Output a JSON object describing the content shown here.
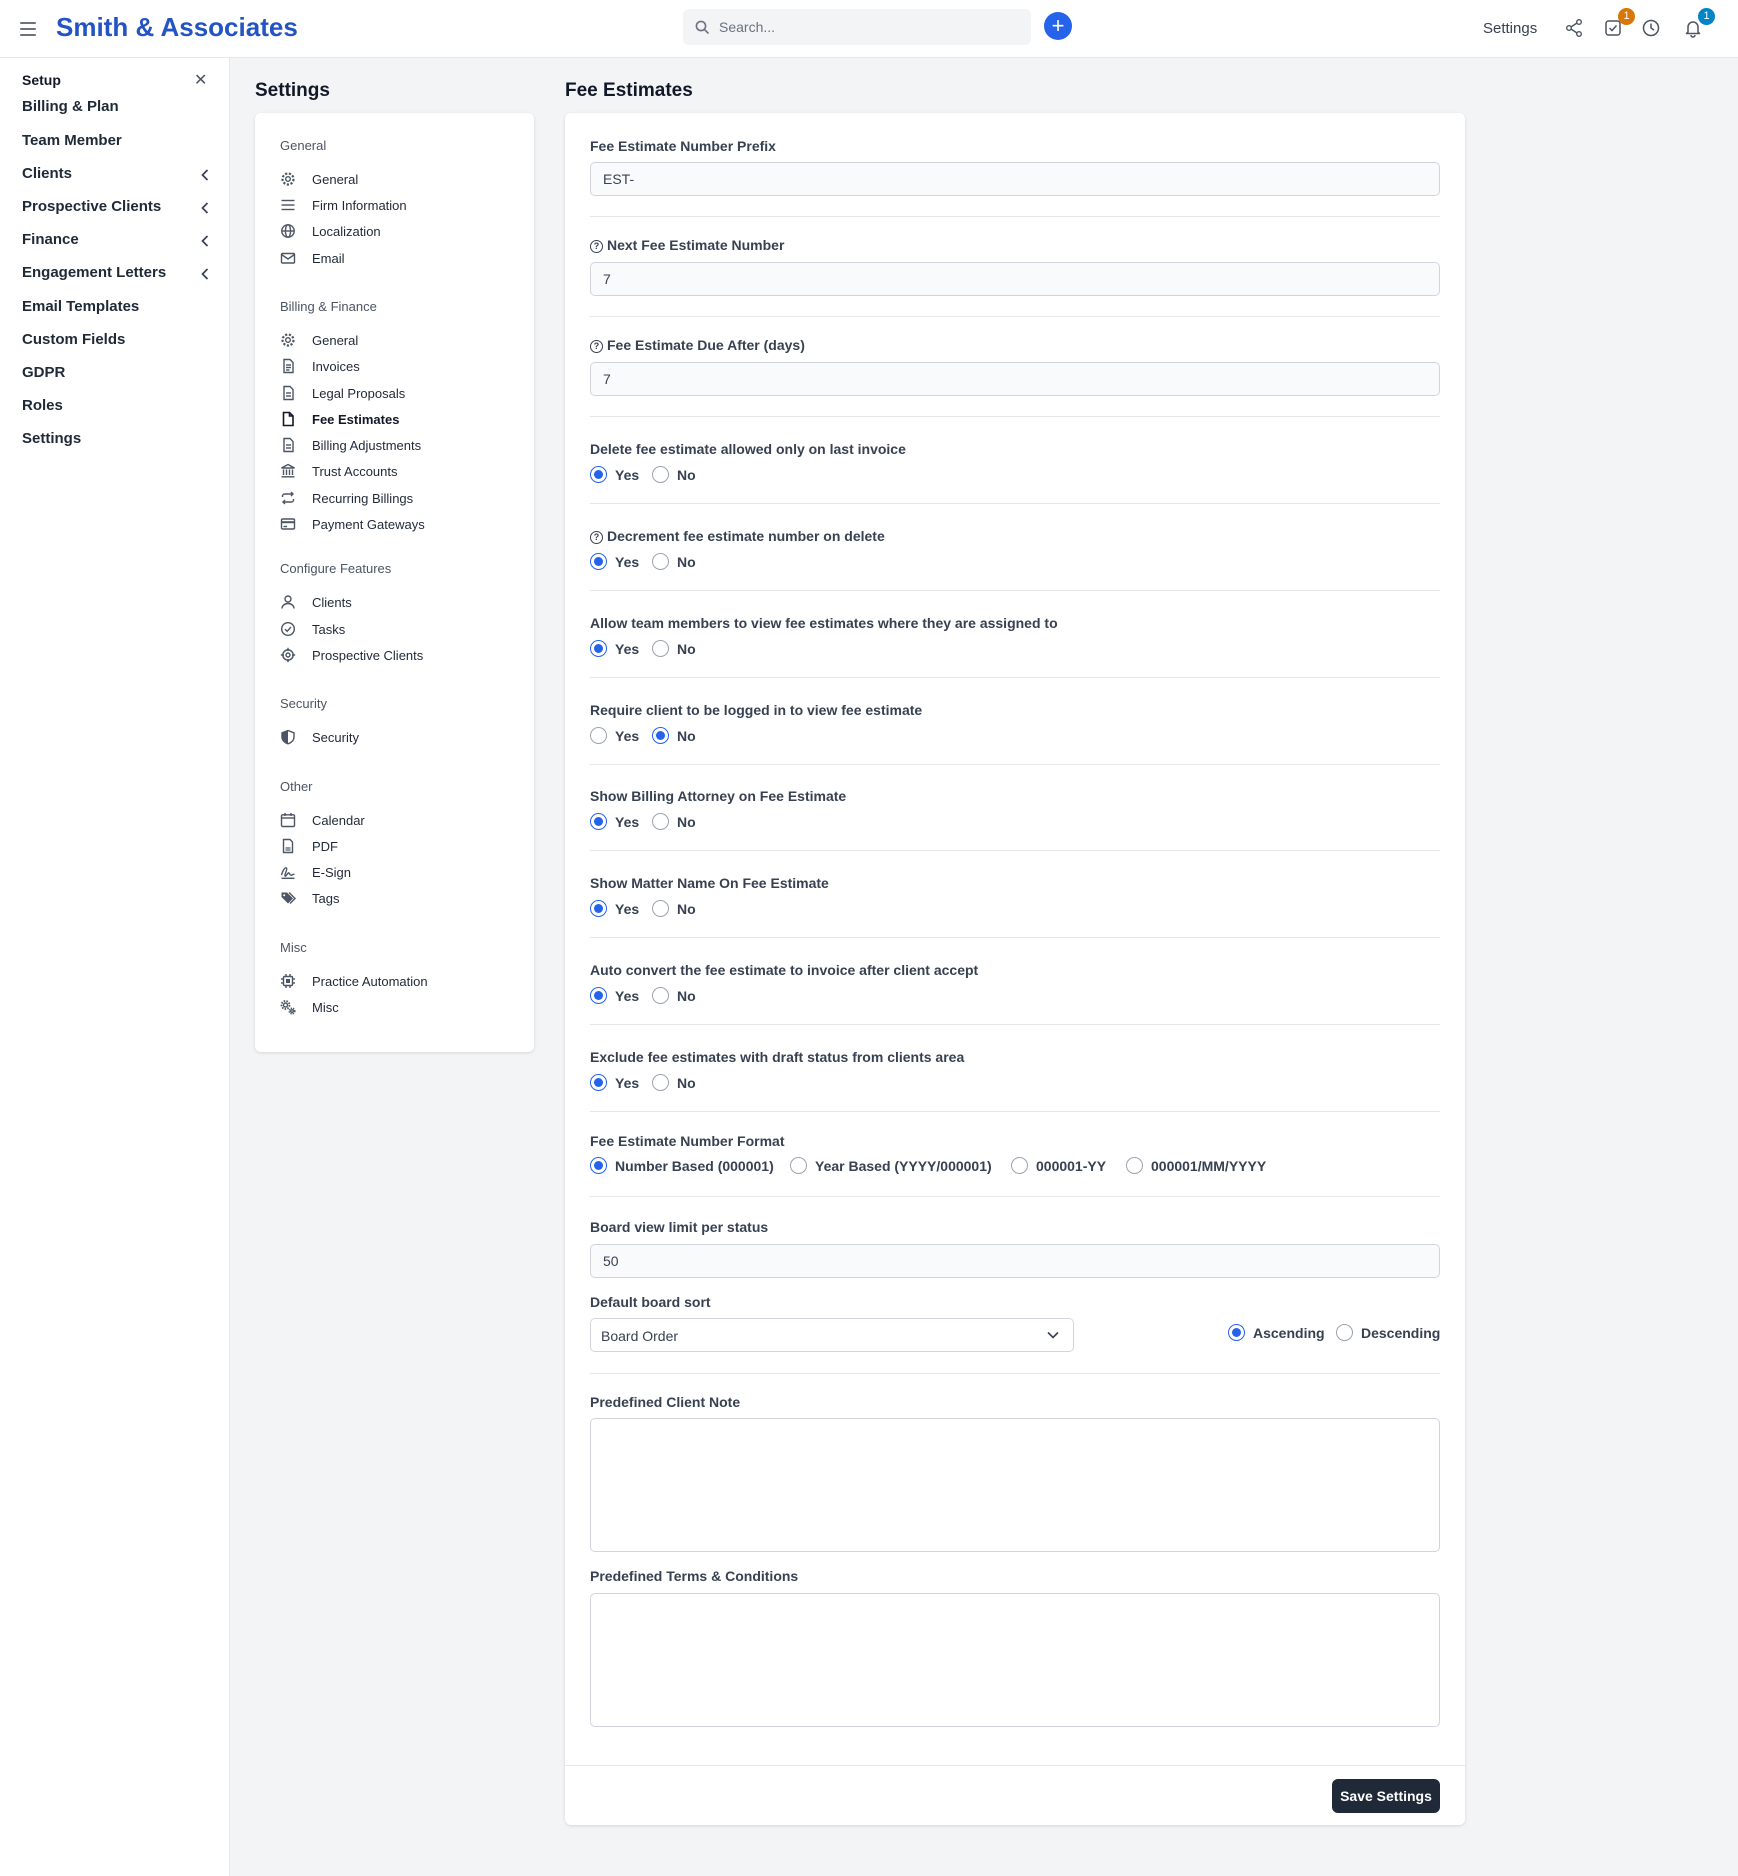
{
  "app": {
    "brand": "Smith & Associates",
    "search_placeholder": "Search...",
    "settings_link": "Settings",
    "tasks_badge": "1",
    "notifications_badge": "1",
    "colors": {
      "brand": "#2454c4",
      "primary": "#2563eb",
      "tasks_badge": "#d97706",
      "notify_badge": "#0284c7",
      "dark_button": "#1f2937"
    }
  },
  "setup": {
    "title": "Setup",
    "items": [
      {
        "label": "Billing & Plan",
        "has_chevron": false
      },
      {
        "label": "Team Member",
        "has_chevron": false
      },
      {
        "label": "Clients",
        "has_chevron": true
      },
      {
        "label": "Prospective Clients",
        "has_chevron": true
      },
      {
        "label": "Finance",
        "has_chevron": true
      },
      {
        "label": "Engagement Letters",
        "has_chevron": true
      },
      {
        "label": "Email Templates",
        "has_chevron": false
      },
      {
        "label": "Custom Fields",
        "has_chevron": false
      },
      {
        "label": "GDPR",
        "has_chevron": false
      },
      {
        "label": "Roles",
        "has_chevron": false
      },
      {
        "label": "Settings",
        "has_chevron": false
      }
    ]
  },
  "settings_nav": {
    "title": "Settings",
    "groups": [
      {
        "label": "General",
        "items": [
          {
            "label": "General",
            "icon": "gear-icon"
          },
          {
            "label": "Firm Information",
            "icon": "lines-icon"
          },
          {
            "label": "Localization",
            "icon": "globe-icon"
          },
          {
            "label": "Email",
            "icon": "envelope-icon"
          }
        ]
      },
      {
        "label": "Billing & Finance",
        "items": [
          {
            "label": "General",
            "icon": "gear-icon"
          },
          {
            "label": "Invoices",
            "icon": "invoice-icon"
          },
          {
            "label": "Legal Proposals",
            "icon": "document-icon"
          },
          {
            "label": "Fee Estimates",
            "icon": "file-icon",
            "active": true
          },
          {
            "label": "Billing Adjustments",
            "icon": "document-icon"
          },
          {
            "label": "Trust Accounts",
            "icon": "bank-icon"
          },
          {
            "label": "Recurring Billings",
            "icon": "repeat-icon"
          },
          {
            "label": "Payment Gateways",
            "icon": "credit-card-icon"
          }
        ]
      },
      {
        "label": "Configure Features",
        "items": [
          {
            "label": "Clients",
            "icon": "user-icon"
          },
          {
            "label": "Tasks",
            "icon": "check-circle-icon"
          },
          {
            "label": "Prospective Clients",
            "icon": "crosshair-icon"
          }
        ]
      },
      {
        "label": "Security",
        "items": [
          {
            "label": "Security",
            "icon": "shield-icon"
          }
        ]
      },
      {
        "label": "Other",
        "items": [
          {
            "label": "Calendar",
            "icon": "calendar-icon"
          },
          {
            "label": "PDF",
            "icon": "pdf-icon"
          },
          {
            "label": "E-Sign",
            "icon": "signature-icon"
          },
          {
            "label": "Tags",
            "icon": "tags-icon"
          }
        ]
      },
      {
        "label": "Misc",
        "items": [
          {
            "label": "Practice Automation",
            "icon": "chip-icon"
          },
          {
            "label": "Misc",
            "icon": "gears-icon"
          }
        ]
      }
    ]
  },
  "form": {
    "title": "Fee Estimates",
    "prefix": {
      "label": "Fee Estimate Number Prefix",
      "value": "EST-"
    },
    "next_number": {
      "label": "Next Fee Estimate Number",
      "value": "7"
    },
    "due_after": {
      "label": "Fee Estimate Due After (days)",
      "value": "7"
    },
    "yes_label": "Yes",
    "no_label": "No",
    "toggles": [
      {
        "label": "Delete fee estimate allowed only on last invoice",
        "value": "yes",
        "help": false
      },
      {
        "label": "Decrement fee estimate number on delete",
        "value": "yes",
        "help": true
      },
      {
        "label": "Allow team members to view fee estimates where they are assigned to",
        "value": "yes",
        "help": false
      },
      {
        "label": "Require client to be logged in to view fee estimate",
        "value": "no",
        "help": false
      },
      {
        "label": "Show Billing Attorney on Fee Estimate",
        "value": "yes",
        "help": false
      },
      {
        "label": "Show Matter Name On Fee Estimate",
        "value": "yes",
        "help": false
      },
      {
        "label": "Auto convert the fee estimate to invoice after client accept",
        "value": "yes",
        "help": false
      },
      {
        "label": "Exclude fee estimates with draft status from clients area",
        "value": "yes",
        "help": false
      }
    ],
    "number_format": {
      "label": "Fee Estimate Number Format",
      "options": [
        "Number Based (000001)",
        "Year Based (YYYY/000001)",
        "000001-YY",
        "000001/MM/YYYY"
      ],
      "selected": "Number Based (000001)"
    },
    "board_limit": {
      "label": "Board view limit per status",
      "value": "50"
    },
    "board_sort": {
      "label": "Default board sort",
      "selected": "Board Order",
      "directions": [
        "Ascending",
        "Descending"
      ],
      "direction_selected": "Ascending"
    },
    "client_note": {
      "label": "Predefined Client Note",
      "value": ""
    },
    "terms": {
      "label": "Predefined Terms & Conditions",
      "value": ""
    },
    "save_label": "Save Settings"
  }
}
